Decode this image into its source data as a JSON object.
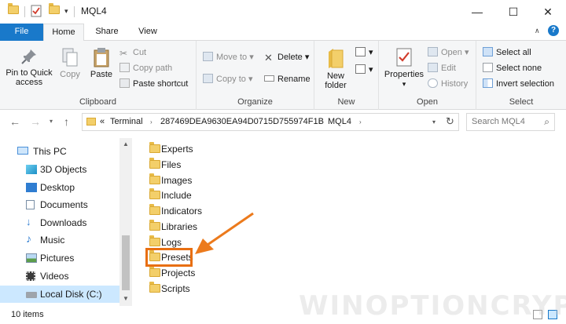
{
  "window": {
    "title": "MQL4",
    "controls": {
      "minimize": "—",
      "maximize": "☐",
      "close": "✕"
    }
  },
  "ribbon_tabs": [
    {
      "label": "File",
      "active": false
    },
    {
      "label": "Home",
      "active": true
    },
    {
      "label": "Share",
      "active": false
    },
    {
      "label": "View",
      "active": false
    }
  ],
  "ribbon": {
    "clipboard": {
      "label": "Clipboard",
      "pin_line1": "Pin to Quick",
      "pin_line2": "access",
      "copy": "Copy",
      "paste": "Paste",
      "cut": "Cut",
      "copy_path": "Copy path",
      "paste_shortcut": "Paste shortcut"
    },
    "organize": {
      "label": "Organize",
      "move_to": "Move to",
      "copy_to": "Copy to",
      "delete": "Delete",
      "rename": "Rename"
    },
    "new": {
      "label": "New",
      "new_folder_line1": "New",
      "new_folder_line2": "folder"
    },
    "open": {
      "label": "Open",
      "properties": "Properties",
      "open": "Open",
      "edit": "Edit",
      "history": "History"
    },
    "select": {
      "label": "Select",
      "select_all": "Select all",
      "select_none": "Select none",
      "invert_selection": "Invert selection"
    }
  },
  "address": {
    "overflow": "«",
    "crumbs": [
      "Terminal",
      "287469DEA9630EA94D0715D755974F1B",
      "MQL4"
    ],
    "search_placeholder": "Search MQL4"
  },
  "nav_pane": [
    {
      "label": "This PC",
      "icon": "pc-icon",
      "selected": false
    },
    {
      "label": "3D Objects",
      "icon": "cube-icon",
      "selected": false
    },
    {
      "label": "Desktop",
      "icon": "desktop-icon",
      "selected": false
    },
    {
      "label": "Documents",
      "icon": "document-icon",
      "selected": false
    },
    {
      "label": "Downloads",
      "icon": "download-icon",
      "selected": false
    },
    {
      "label": "Music",
      "icon": "music-icon",
      "selected": false
    },
    {
      "label": "Pictures",
      "icon": "picture-icon",
      "selected": false
    },
    {
      "label": "Videos",
      "icon": "video-icon",
      "selected": false
    },
    {
      "label": "Local Disk (C:)",
      "icon": "drive-icon",
      "selected": true
    }
  ],
  "files": [
    "Experts",
    "Files",
    "Images",
    "Include",
    "Indicators",
    "Libraries",
    "Logs",
    "Presets",
    "Projects",
    "Scripts"
  ],
  "highlighted_file": "Presets",
  "status": {
    "item_count": "10 items"
  },
  "watermark": "WINOPTIONCRYPTO.COM",
  "colors": {
    "accent": "#1979ca",
    "highlight": "#e86f12",
    "selected": "#cce8ff"
  }
}
